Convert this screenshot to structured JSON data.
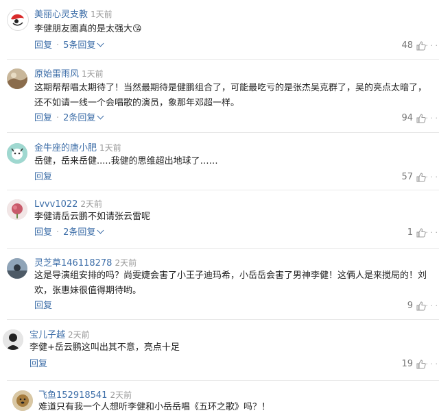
{
  "comments": [
    {
      "name": "美丽心灵支教",
      "time": "1天前",
      "text": "李健朋友圈真的是太强大😘",
      "reply": "回复",
      "more_replies": "5条回复",
      "likes": "48"
    },
    {
      "name": "原始雷雨风",
      "time": "1天前",
      "text": "这期帮帮唱太期待了！当然最期待是健鹏组合了，可能最吃亏的是张杰吴克群了，吴的亮点太暗了，还不如请一线一个会唱歌的演员，象那年邓超一样。",
      "reply": "回复",
      "more_replies": "2条回复",
      "likes": "94"
    },
    {
      "name": "金牛座的唐小肥",
      "time": "1天前",
      "text": "岳健，岳来岳健.....我健的思维超出地球了……",
      "reply": "回复",
      "more_replies": "",
      "likes": "57"
    },
    {
      "name": "Lvvv1022",
      "time": "2天前",
      "text": "李健请岳云鹏不如请张云雷呢",
      "reply": "回复",
      "more_replies": "2条回复",
      "likes": "1"
    },
    {
      "name": "灵芝草146118278",
      "time": "2天前",
      "text": "这是导演组安排的吗？尚雯婕会害了小王子迪玛希，小岳岳会害了男神李健！这俩人是来搅局的！刘欢，张惠妹很值得期待哟。",
      "reply": "回复",
      "more_replies": "",
      "likes": "9"
    },
    {
      "name": "宝儿子越",
      "time": "2天前",
      "text": "李健+岳云鹏这叫出其不意，亮点十足",
      "reply": "回复",
      "more_replies": "",
      "likes": "19"
    },
    {
      "name": "飞鱼152918541",
      "time": "2天前",
      "text": "难道只有我一个人想听李健和小岳岳唱《五环之歌》吗？！",
      "reply": "",
      "more_replies": "",
      "likes": ""
    }
  ],
  "more_glyph": "· · ·",
  "dot": "·",
  "icons": {
    "like": "thumbs-up-icon",
    "more": "more-dots-icon"
  },
  "colors": {
    "name": "#3d6ea8",
    "meta": "#999999",
    "text": "#222222"
  }
}
